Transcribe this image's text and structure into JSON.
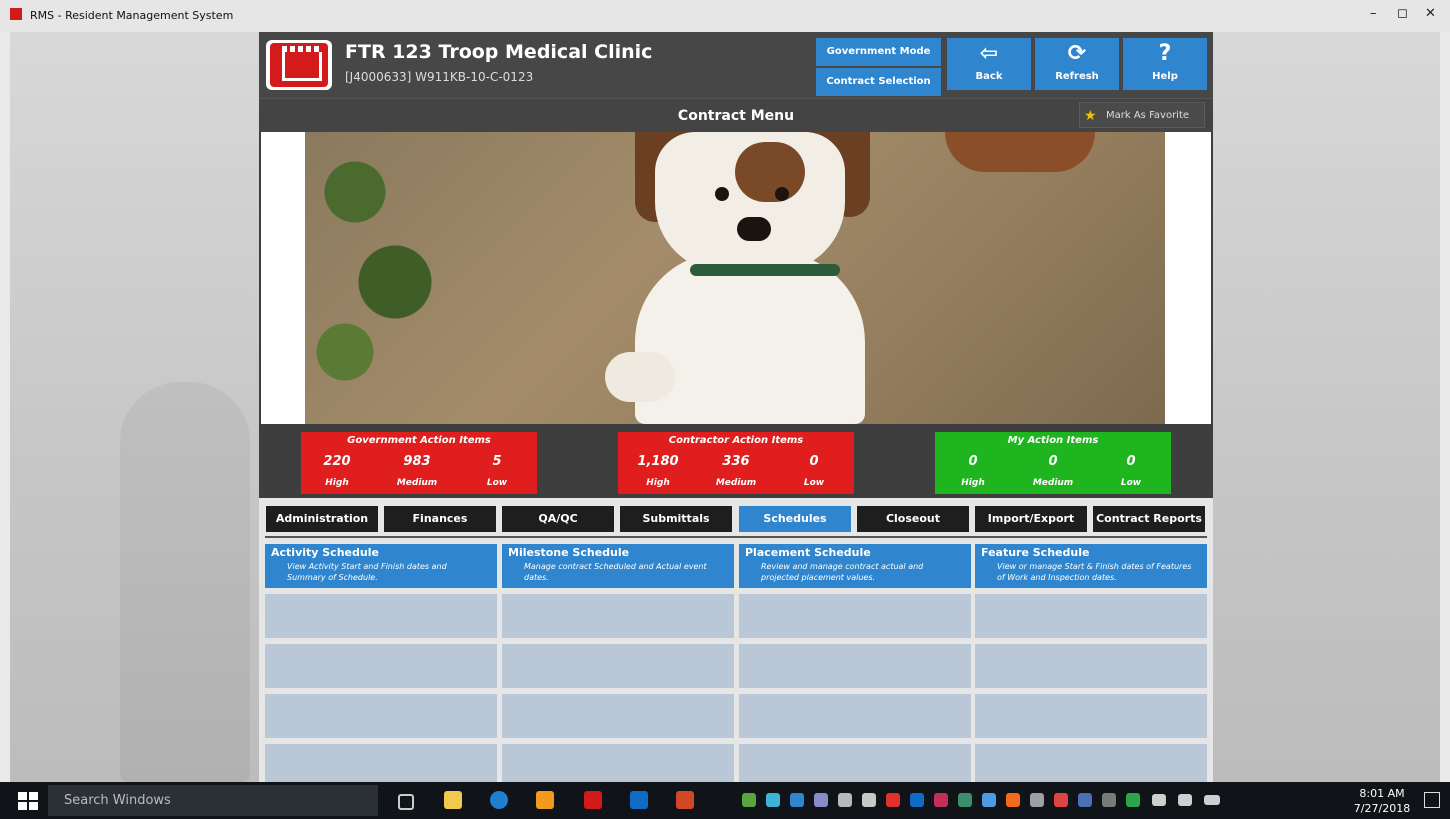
{
  "window": {
    "title": "RMS - Resident Management System",
    "minimize": "–",
    "restore": "◻",
    "close": "✕"
  },
  "header": {
    "project_title": "FTR 123 Troop Medical Clinic",
    "project_sub": "[J4000633] W911KB-10-C-0123",
    "gov_mode_home": "Government Mode Home",
    "contract_selection": "Contract Selection",
    "back": {
      "label": "Back",
      "icon": "⇦"
    },
    "refresh": {
      "label": "Refresh",
      "icon": "⟳"
    },
    "help": {
      "label": "Help",
      "icon": "?"
    }
  },
  "menu": {
    "title": "Contract Menu",
    "favorite": "Mark As Favorite"
  },
  "action_items": [
    {
      "title": "Government Action Items",
      "values": [
        "220",
        "983",
        "5"
      ],
      "levels": [
        "High",
        "Medium",
        "Low"
      ],
      "color": "#e01e1e"
    },
    {
      "title": "Contractor Action Items",
      "values": [
        "1,180",
        "336",
        "0"
      ],
      "levels": [
        "High",
        "Medium",
        "Low"
      ],
      "color": "#e01e1e"
    },
    {
      "title": "My Action Items",
      "values": [
        "0",
        "0",
        "0"
      ],
      "levels": [
        "High",
        "Medium",
        "Low"
      ],
      "color": "#1fb51f"
    }
  ],
  "tabs": [
    "Administration",
    "Finances",
    "QA/QC",
    "Submittals",
    "Schedules",
    "Closeout",
    "Import/Export",
    "Contract Reports"
  ],
  "active_tab": "Schedules",
  "cards": [
    {
      "title": "Activity Schedule",
      "desc": "View Activity Start and Finish dates and Summary of Schedule."
    },
    {
      "title": "Milestone Schedule",
      "desc": "Manage contract Scheduled and Actual event dates."
    },
    {
      "title": "Placement Schedule",
      "desc": "Review and manage contract actual and projected placement values."
    },
    {
      "title": "Feature Schedule",
      "desc": "View or manage Start & Finish dates of Features of Work and Inspection dates."
    }
  ],
  "taskbar": {
    "search": "Search Windows",
    "time": "8:01 AM",
    "date": "7/27/2018"
  },
  "colors": {
    "accent": "#2f86cf",
    "header_bg": "#474747",
    "red": "#e01e1e",
    "green": "#1fb51f"
  }
}
